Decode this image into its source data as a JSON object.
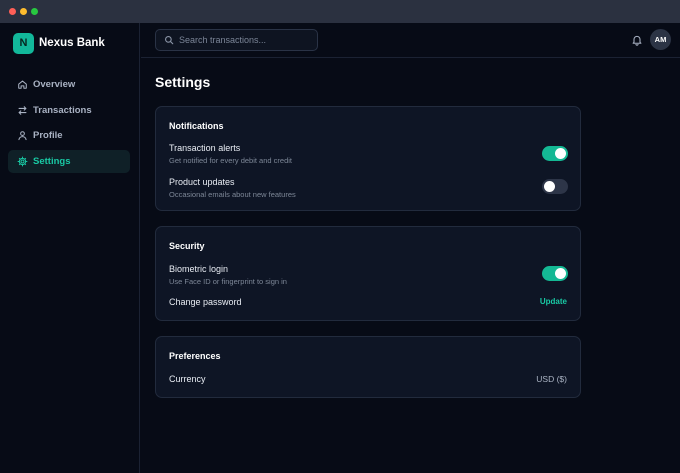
{
  "window": {
    "traffic_lights": [
      "close",
      "minimize",
      "zoom"
    ]
  },
  "brand": {
    "logo_letter": "N",
    "name": "Nexus Bank",
    "accent": "#12b89a"
  },
  "sidebar": {
    "items": [
      {
        "label": "Overview",
        "icon": "home-icon",
        "active": false
      },
      {
        "label": "Transactions",
        "icon": "transfer-arrows-icon",
        "active": false
      },
      {
        "label": "Profile",
        "icon": "user-icon",
        "active": false
      },
      {
        "label": "Settings",
        "icon": "gear-icon",
        "active": true
      }
    ]
  },
  "header": {
    "search": {
      "placeholder": "Search transactions...",
      "value": ""
    },
    "notifications_icon": "bell-icon",
    "avatar_initials": "AM"
  },
  "main": {
    "title": "Settings",
    "notifications": {
      "title": "Notifications",
      "transaction_alerts": {
        "label": "Transaction alerts",
        "description": "Get notified for every debit and credit",
        "enabled": true
      },
      "product_updates": {
        "label": "Product updates",
        "description": "Occasional emails about new features",
        "enabled": false
      }
    },
    "security": {
      "title": "Security",
      "biometric_login": {
        "label": "Biometric login",
        "description": "Use Face ID or fingerprint to sign in",
        "enabled": true
      },
      "change_password": {
        "label": "Change password",
        "action": "Update"
      }
    },
    "preferences": {
      "title": "Preferences",
      "currency": {
        "label": "Currency",
        "value": "USD ($)"
      }
    }
  }
}
